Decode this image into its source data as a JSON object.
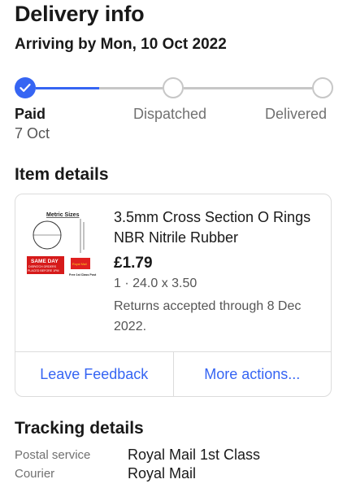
{
  "header": {
    "title": "Delivery info",
    "arrival": "Arriving by Mon, 10 Oct 2022"
  },
  "progress": {
    "steps": [
      {
        "label": "Paid",
        "date": "7 Oct",
        "status": "complete"
      },
      {
        "label": "Dispatched",
        "status": "pending"
      },
      {
        "label": "Delivered",
        "status": "pending"
      }
    ],
    "segment1_fill": 0.5,
    "accent_color": "#3665f3",
    "inactive_color": "#c7c7c7"
  },
  "item_details": {
    "heading": "Item details",
    "title": "3.5mm Cross Section O Rings NBR Nitrile Rubber",
    "price": "£1.79",
    "quantity_variant": "1 · 24.0 x 3.50",
    "returns": "Returns accepted through 8 Dec 2022.",
    "thumbnail": {
      "heading": "Metric Sizes",
      "badge_line1": "SAME DAY",
      "badge_line2": "DISPATCH ORDERS",
      "badge_line3": "PLACED BEFORE 1PM",
      "post_label": "Royal Mail",
      "post_sub": "Free 1st Class Post"
    },
    "actions": {
      "feedback": "Leave Feedback",
      "more": "More actions..."
    }
  },
  "tracking": {
    "heading": "Tracking details",
    "rows": [
      {
        "label": "Postal service",
        "value": "Royal Mail 1st Class"
      },
      {
        "label": "Courier",
        "value": "Royal Mail"
      }
    ]
  },
  "colors": {
    "link": "#3665f3",
    "text": "#191919",
    "muted": "#707070",
    "border": "#dcdcdc"
  }
}
